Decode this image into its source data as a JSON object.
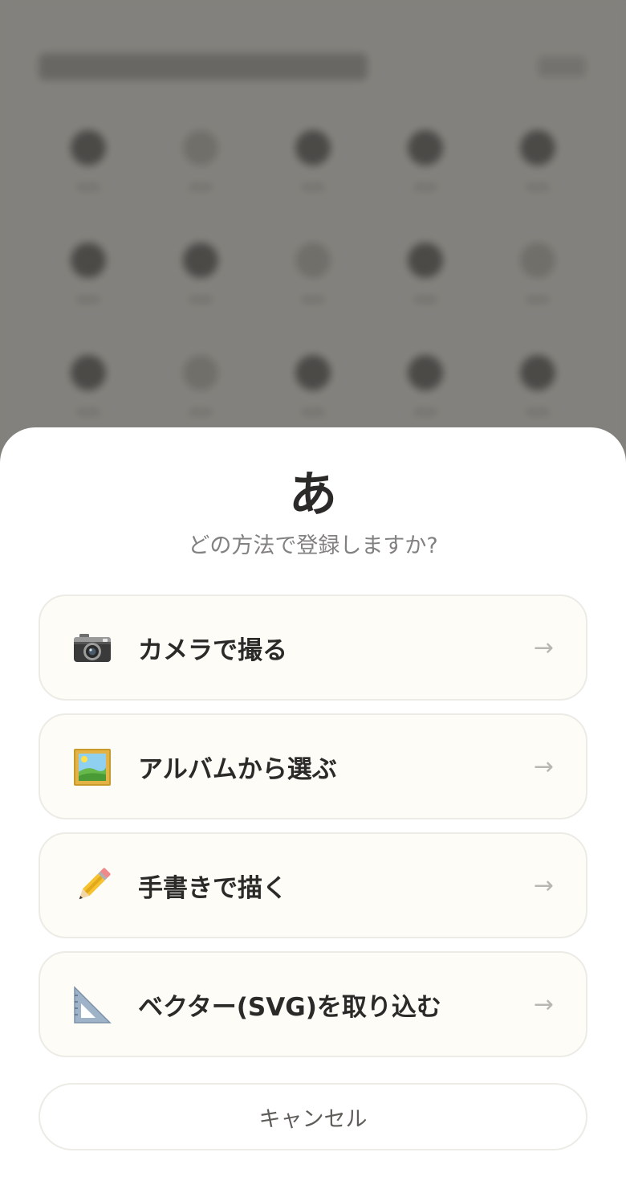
{
  "sheet": {
    "character": "あ",
    "subtitle": "どの方法で登録しますか?",
    "options": [
      {
        "icon": "camera-icon",
        "label": "カメラで撮る",
        "arrow": "→"
      },
      {
        "icon": "framed-picture-icon",
        "label": "アルバムから選ぶ",
        "arrow": "→"
      },
      {
        "icon": "pencil-icon",
        "label": "手書きで描く",
        "arrow": "→"
      },
      {
        "icon": "triangle-ruler-icon",
        "label": "ベクター(SVG)を取り込む",
        "arrow": "→"
      }
    ],
    "cancel_label": "キャンセル"
  },
  "colors": {
    "option_background": "#fdfcf7",
    "option_border": "#ecebe6",
    "text_primary": "#2b2a28",
    "text_secondary": "#828080",
    "arrow": "#b9b7b2",
    "backdrop": "#8a8884"
  }
}
